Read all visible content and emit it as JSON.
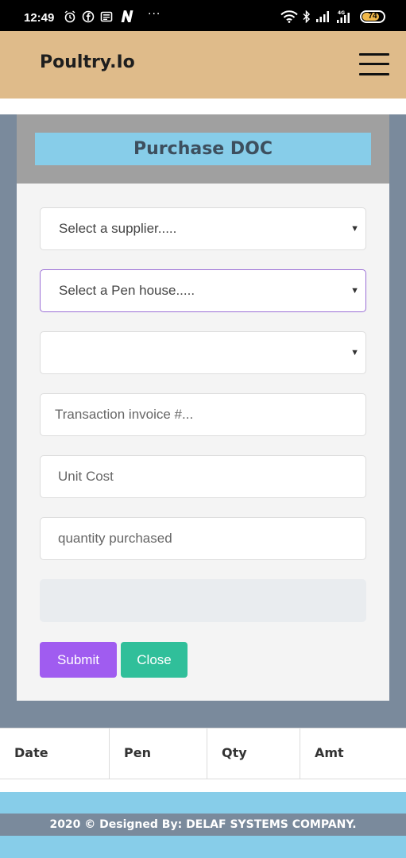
{
  "status_bar": {
    "time": "12:49",
    "battery": "74",
    "network": "4G"
  },
  "navbar": {
    "brand": "Poultry.Io"
  },
  "modal": {
    "title": "Purchase DOC",
    "supplier_select": "Select a supplier.....",
    "pen_select": "Select a Pen house.....",
    "third_select": "",
    "invoice_placeholder": "Transaction invoice #...",
    "unit_cost_placeholder": "Unit Cost",
    "quantity_placeholder": "quantity purchased",
    "total_value": "",
    "submit_label": "Submit",
    "close_label": "Close"
  },
  "table": {
    "headers": [
      "Date",
      "Pen",
      "Qty",
      "Amt"
    ]
  },
  "footer": {
    "text": "2020 © Designed By: DELAF SYSTEMS COMPANY."
  },
  "colors": {
    "navbar": "#dfbb8a",
    "title_bg": "#87cde9",
    "backdrop": "#7a8a9c",
    "submit": "#a05cf0",
    "close": "#30bf9a"
  },
  "icons": [
    "alarm-icon",
    "facebook-icon",
    "news-icon",
    "n-app-icon",
    "wifi-icon",
    "bluetooth-icon",
    "signal-icon",
    "battery-icon",
    "menu-icon",
    "dropdown-caret-icon"
  ]
}
